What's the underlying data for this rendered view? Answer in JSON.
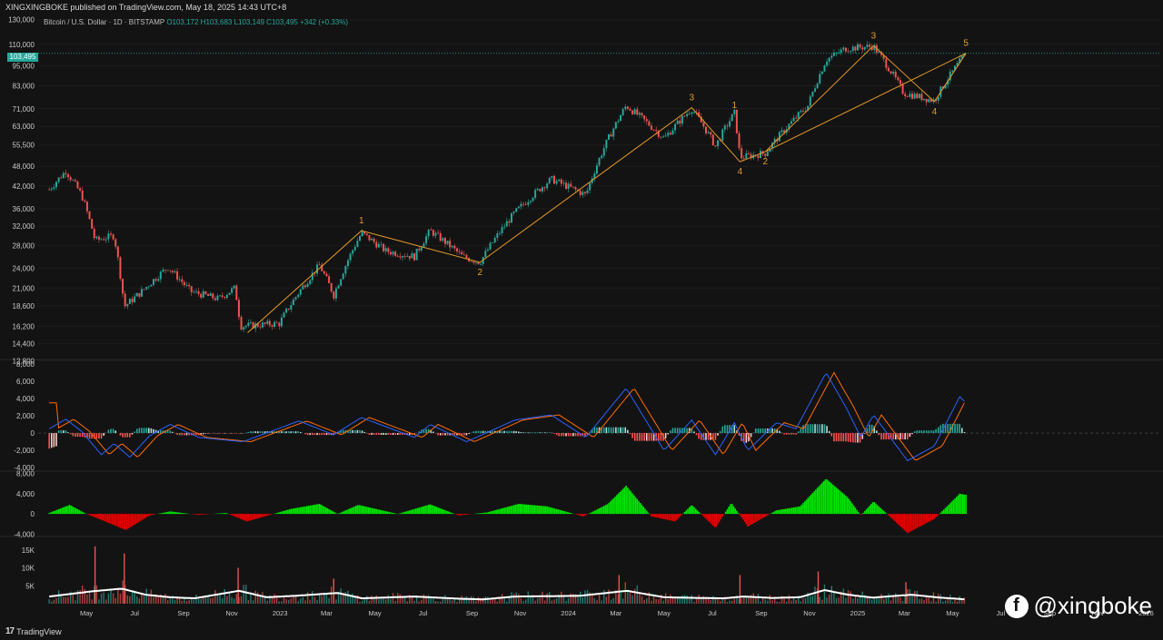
{
  "header": {
    "publisher_line": "XINGXINGBOKE published on TradingView.com, May 18, 2025 14:43 UTC+8"
  },
  "legend": {
    "symbol": "Bitcoin / U.S. Dollar · 1D · BITSTAMP",
    "ohlc": "O103,172 H103,683 L103,149 C103,495 +342 (+0.33%)"
  },
  "price_label": "103,495",
  "footer": {
    "logo_text": "TradingView",
    "logo_mark": "17"
  },
  "watermark": {
    "text": "@xingboke",
    "icon": "facebook-icon"
  },
  "colors": {
    "background": "#131313",
    "wave_line": "#e69a28",
    "up": "#26a69a",
    "down": "#ef5350",
    "macd_line": "#2962ff",
    "signal_line": "#ff6d00",
    "osc_up": "#00e600",
    "osc_down": "#e60000",
    "volume_ma": "#ffffff"
  },
  "chart_data": [
    {
      "type": "line",
      "title": "Bitcoin / U.S. Dollar · 1D · BITSTAMP",
      "scale": "log",
      "ylim": [
        13000,
        133000
      ],
      "y_ticks": [
        "130,000",
        "110,000",
        "95,000",
        "83,000",
        "71,000",
        "63,000",
        "55,500",
        "48,000",
        "42,000",
        "36,000",
        "32,000",
        "28,000",
        "24,000",
        "21,000",
        "18,600",
        "16,200",
        "14,400",
        "12,800"
      ],
      "y_tick_values": [
        130000,
        110000,
        95000,
        83000,
        71000,
        63000,
        55500,
        48000,
        42000,
        36000,
        32000,
        28000,
        24000,
        21000,
        18600,
        16200,
        14400,
        12800
      ],
      "x_ticks": [
        "May",
        "Jul",
        "Sep",
        "Nov",
        "2023",
        "Mar",
        "May",
        "Jul",
        "Sep",
        "Nov",
        "2024",
        "Mar",
        "May",
        "Jul",
        "Sep",
        "Nov",
        "2025",
        "Mar",
        "May",
        "Jul",
        "Sep",
        "Nov",
        "2026"
      ],
      "x_tick_dates": [
        "2022-05",
        "2022-07",
        "2022-09",
        "2022-11",
        "2023-01",
        "2023-03",
        "2023-05",
        "2023-07",
        "2023-09",
        "2023-11",
        "2024-01",
        "2024-03",
        "2024-05",
        "2024-07",
        "2024-09",
        "2024-11",
        "2025-01",
        "2025-03",
        "2025-05",
        "2025-07",
        "2025-09",
        "2025-11",
        "2026-01"
      ],
      "series": [
        {
          "values_by_date": [
            [
              "2022-03-15",
              41000
            ],
            [
              "2022-04-05",
              46500
            ],
            [
              "2022-04-25",
              39500
            ],
            [
              "2022-05-12",
              29000
            ],
            [
              "2022-06-05",
              30000
            ],
            [
              "2022-06-18",
              18500
            ],
            [
              "2022-07-10",
              20500
            ],
            [
              "2022-08-12",
              24200
            ],
            [
              "2022-09-10",
              20500
            ],
            [
              "2022-10-15",
              19500
            ],
            [
              "2022-11-05",
              21000
            ],
            [
              "2022-11-12",
              16200
            ],
            [
              "2022-12-31",
              16500
            ],
            [
              "2023-02-20",
              24500
            ],
            [
              "2023-03-10",
              20000
            ],
            [
              "2023-04-14",
              30500
            ],
            [
              "2023-05-15",
              27000
            ],
            [
              "2023-06-20",
              26000
            ],
            [
              "2023-07-10",
              31000
            ],
            [
              "2023-08-20",
              26000
            ],
            [
              "2023-09-11",
              25000
            ],
            [
              "2023-10-25",
              35000
            ],
            [
              "2023-12-10",
              44000
            ],
            [
              "2024-01-23",
              39500
            ],
            [
              "2024-03-14",
              72500
            ],
            [
              "2024-05-01",
              58000
            ],
            [
              "2024-06-05",
              71000
            ],
            [
              "2024-07-05",
              55000
            ],
            [
              "2024-07-29",
              69000
            ],
            [
              "2024-08-05",
              51000
            ],
            [
              "2024-09-06",
              52500
            ],
            [
              "2024-10-30",
              72500
            ],
            [
              "2024-11-22",
              99000
            ],
            [
              "2024-12-17",
              107000
            ],
            [
              "2025-01-21",
              108500
            ],
            [
              "2025-02-28",
              79000
            ],
            [
              "2025-04-08",
              75000
            ],
            [
              "2025-05-18",
              103495
            ]
          ]
        }
      ],
      "wave_path": [
        [
          "2022-11-21",
          15500
        ],
        [
          "2023-04-14",
          31000
        ],
        [
          "2023-09-11",
          25000
        ],
        [
          "2024-06-05",
          71500
        ],
        [
          "2024-08-05",
          49500
        ],
        [
          "2024-09-06",
          53000
        ],
        [
          "2025-05-18",
          103500
        ]
      ],
      "wave_outer_path": [
        [
          "2024-09-06",
          53000
        ],
        [
          "2025-01-21",
          109000
        ],
        [
          "2025-04-08",
          74500
        ],
        [
          "2025-05-18",
          103500
        ]
      ],
      "wave_labels": [
        {
          "text": "1",
          "date": "2023-04-14",
          "value": 31000,
          "pos": "above"
        },
        {
          "text": "2",
          "date": "2023-09-11",
          "value": 25000,
          "pos": "below"
        },
        {
          "text": "3",
          "date": "2024-06-05",
          "value": 71500,
          "pos": "above"
        },
        {
          "text": "1",
          "date": "2024-07-29",
          "value": 68000,
          "pos": "above"
        },
        {
          "text": "4",
          "date": "2024-08-05",
          "value": 49500,
          "pos": "below"
        },
        {
          "text": "2",
          "date": "2024-09-06",
          "value": 53000,
          "pos": "below"
        },
        {
          "text": "3",
          "date": "2025-01-21",
          "value": 109000,
          "pos": "above"
        },
        {
          "text": "4",
          "date": "2025-04-08",
          "value": 74500,
          "pos": "below"
        },
        {
          "text": "5",
          "date": "2025-05-18",
          "value": 103500,
          "pos": "above"
        }
      ],
      "last_price": 103495
    },
    {
      "type": "line",
      "y_ticks": [
        "8,000",
        "6,000",
        "4,000",
        "2,000",
        "0",
        "-2,000",
        "-4,000"
      ],
      "y_tick_values": [
        8000,
        6000,
        4000,
        2000,
        0,
        -2000,
        -4000
      ],
      "ylim": [
        -4300,
        8300
      ],
      "series": [
        {
          "values_by_date": [
            [
              "2022-03-15",
              500
            ],
            [
              "2022-04-05",
              1600
            ],
            [
              "2022-04-25",
              200
            ],
            [
              "2022-05-20",
              -2500
            ],
            [
              "2022-06-05",
              -1200
            ],
            [
              "2022-06-25",
              -2800
            ],
            [
              "2022-07-20",
              -300
            ],
            [
              "2022-08-15",
              1000
            ],
            [
              "2022-09-20",
              -500
            ],
            [
              "2022-11-15",
              -1000
            ],
            [
              "2023-01-25",
              1400
            ],
            [
              "2023-03-10",
              -200
            ],
            [
              "2023-04-14",
              1800
            ],
            [
              "2023-06-20",
              -500
            ],
            [
              "2023-07-10",
              1000
            ],
            [
              "2023-08-25",
              -1000
            ],
            [
              "2023-10-25",
              1500
            ],
            [
              "2023-12-10",
              2100
            ],
            [
              "2024-01-23",
              -500
            ],
            [
              "2024-03-14",
              5200
            ],
            [
              "2024-05-01",
              -2000
            ],
            [
              "2024-06-05",
              1500
            ],
            [
              "2024-07-05",
              -2500
            ],
            [
              "2024-07-29",
              1200
            ],
            [
              "2024-08-15",
              -2000
            ],
            [
              "2024-09-20",
              1200
            ],
            [
              "2024-10-15",
              500
            ],
            [
              "2024-11-22",
              7000
            ],
            [
              "2024-12-17",
              3000
            ],
            [
              "2025-01-05",
              -500
            ],
            [
              "2025-01-21",
              2100
            ],
            [
              "2025-03-05",
              -3200
            ],
            [
              "2025-04-08",
              -1500
            ],
            [
              "2025-05-10",
              4200
            ],
            [
              "2025-05-18",
              3500
            ]
          ]
        }
      ]
    },
    {
      "type": "area",
      "y_ticks": [
        "8,000",
        "4,000",
        "0",
        "-4,000"
      ],
      "y_tick_values": [
        8000,
        4000,
        0,
        -4000
      ],
      "ylim": [
        -4300,
        8300
      ],
      "series": [
        {
          "values_by_date": [
            [
              "2022-03-15",
              200
            ],
            [
              "2022-04-10",
              1800
            ],
            [
              "2022-05-01",
              0
            ],
            [
              "2022-05-25",
              -1500
            ],
            [
              "2022-06-20",
              -3200
            ],
            [
              "2022-07-20",
              -300
            ],
            [
              "2022-08-15",
              500
            ],
            [
              "2022-09-20",
              -200
            ],
            [
              "2022-10-25",
              200
            ],
            [
              "2022-11-20",
              -1500
            ],
            [
              "2023-01-15",
              1000
            ],
            [
              "2023-02-20",
              2000
            ],
            [
              "2023-03-15",
              0
            ],
            [
              "2023-04-10",
              1800
            ],
            [
              "2023-05-30",
              0
            ],
            [
              "2023-07-10",
              1900
            ],
            [
              "2023-08-15",
              -300
            ],
            [
              "2023-09-20",
              300
            ],
            [
              "2023-10-30",
              2000
            ],
            [
              "2023-12-05",
              1500
            ],
            [
              "2024-01-20",
              -500
            ],
            [
              "2024-02-20",
              2000
            ],
            [
              "2024-03-14",
              5600
            ],
            [
              "2024-04-15",
              -500
            ],
            [
              "2024-05-15",
              -1500
            ],
            [
              "2024-06-05",
              1800
            ],
            [
              "2024-07-05",
              -2800
            ],
            [
              "2024-07-25",
              2200
            ],
            [
              "2024-08-15",
              -2500
            ],
            [
              "2024-09-20",
              700
            ],
            [
              "2024-10-20",
              1500
            ],
            [
              "2024-11-22",
              7000
            ],
            [
              "2024-12-20",
              3200
            ],
            [
              "2025-01-05",
              -300
            ],
            [
              "2025-01-21",
              2500
            ],
            [
              "2025-03-05",
              -3800
            ],
            [
              "2025-04-08",
              -1000
            ],
            [
              "2025-05-10",
              4000
            ],
            [
              "2025-05-18",
              3800
            ]
          ]
        }
      ]
    },
    {
      "type": "bar",
      "y_ticks": [
        "15K",
        "10K",
        "5K"
      ],
      "y_tick_values": [
        15000,
        10000,
        5000
      ],
      "ylim": [
        0,
        18500
      ],
      "series": [
        {
          "values_by_date": [
            [
              "2022-03-15",
              2000
            ],
            [
              "2022-05-10",
              3500
            ],
            [
              "2022-06-15",
              4200
            ],
            [
              "2022-07-15",
              2500
            ],
            [
              "2022-08-15",
              1800
            ],
            [
              "2022-09-15",
              1500
            ],
            [
              "2022-11-10",
              3600
            ],
            [
              "2022-12-15",
              1800
            ],
            [
              "2023-01-20",
              2200
            ],
            [
              "2023-03-15",
              3000
            ],
            [
              "2023-04-15",
              1500
            ],
            [
              "2023-06-20",
              2000
            ],
            [
              "2023-08-15",
              1400
            ],
            [
              "2023-09-15",
              1200
            ],
            [
              "2023-10-25",
              2000
            ],
            [
              "2023-12-10",
              2100
            ],
            [
              "2024-01-15",
              2200
            ],
            [
              "2024-03-15",
              3600
            ],
            [
              "2024-05-01",
              1800
            ],
            [
              "2024-06-15",
              1600
            ],
            [
              "2024-07-15",
              1500
            ],
            [
              "2024-08-10",
              2000
            ],
            [
              "2024-09-15",
              1600
            ],
            [
              "2024-10-20",
              1800
            ],
            [
              "2024-11-20",
              3800
            ],
            [
              "2024-12-20",
              2500
            ],
            [
              "2025-01-20",
              1700
            ],
            [
              "2025-03-10",
              2500
            ],
            [
              "2025-04-15",
              1700
            ],
            [
              "2025-05-18",
              1200
            ]
          ]
        }
      ],
      "spikes_by_date": [
        [
          "2022-05-12",
          16000
        ],
        [
          "2022-06-18",
          14000
        ],
        [
          "2022-11-09",
          10000
        ],
        [
          "2023-03-10",
          7000
        ],
        [
          "2024-03-05",
          8000
        ],
        [
          "2024-08-05",
          8000
        ],
        [
          "2024-11-12",
          9000
        ],
        [
          "2025-03-03",
          6000
        ]
      ]
    }
  ]
}
